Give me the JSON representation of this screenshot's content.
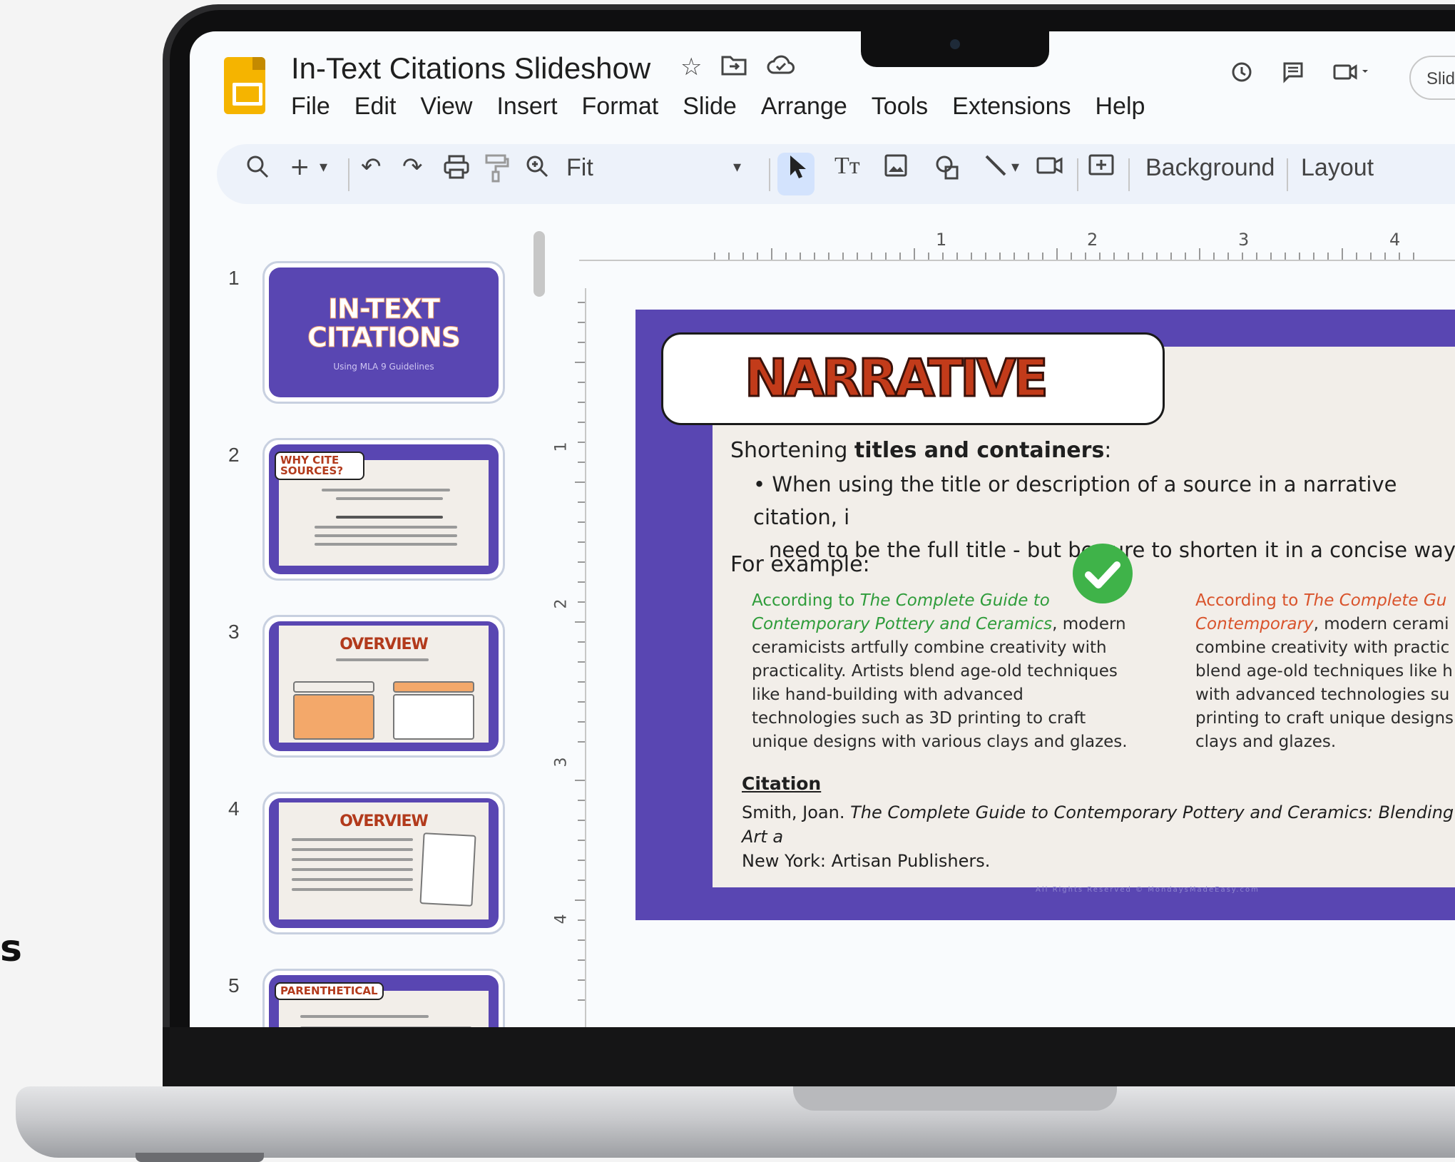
{
  "stray_char": "s",
  "app": {
    "title": "In-Text Citations Slideshow",
    "menu": [
      "File",
      "Edit",
      "View",
      "Insert",
      "Format",
      "Slide",
      "Arrange",
      "Tools",
      "Extensions",
      "Help"
    ],
    "slideshow_label": "Slid"
  },
  "toolbar": {
    "zoom_label": "Fit",
    "background_label": "Background",
    "layout_label": "Layout"
  },
  "ruler": {
    "h_marks": [
      "1",
      "2",
      "3",
      "4"
    ],
    "v_marks": [
      "1",
      "2",
      "3",
      "4"
    ]
  },
  "filmstrip": {
    "numbers": [
      "1",
      "2",
      "3",
      "4",
      "5"
    ],
    "slide1_title": "IN-TEXT CITATIONS",
    "slide1_subtitle": "Using MLA 9 Guidelines",
    "slide2_badge": "WHY CITE SOURCES?",
    "slide3_title": "OVERVIEW",
    "slide4_title": "OVERVIEW",
    "slide5_badge": "PARENTHETICAL"
  },
  "slide": {
    "heading": "NARRATIVE",
    "shortening_prefix": "Shortening ",
    "shortening_bold": "titles and containers",
    "shortening_suffix": ":",
    "bullet_line1": "When using the title or description of a source in a narrative citation, i",
    "bullet_line2": "need to be the full title - but be sure to shorten it in a concise way.",
    "for_example": "For example:",
    "good": {
      "lead": "According to ",
      "title": "The Complete Guide to Contemporary Pottery and Ceramics",
      "rest1": ", modern",
      "lines": [
        "ceramicists artfully combine creativity with",
        "practicality. Artists blend age-old techniques",
        "like hand-building with advanced",
        "technologies such as 3D printing to craft",
        "unique designs with various clays and glazes."
      ]
    },
    "bad": {
      "lead": "According to ",
      "title_l1": "The Complete Gu",
      "title_l2": "Contemporary",
      "rest1": ", modern cerami",
      "lines": [
        "combine creativity with practic",
        "blend age-old techniques like h",
        "with advanced technologies su",
        "printing to craft unique designs",
        "clays and glazes."
      ]
    },
    "citation_heading": "Citation",
    "citation_prefix": "Smith, Joan. ",
    "citation_title": "The Complete Guide to Contemporary Pottery and Ceramics: Blending Art a",
    "citation_line2": "New York: Artisan Publishers.",
    "footer": "All Rights Reserved © MondaysMadeEasy.com"
  }
}
